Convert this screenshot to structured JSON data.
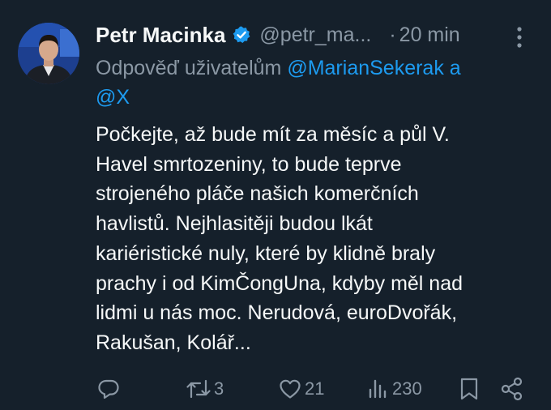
{
  "author": {
    "name": "Petr Macinka",
    "handle": "@petr_ma...",
    "separator": "·",
    "time": "20 min",
    "verified": true,
    "verified_color": "#1d9bf0"
  },
  "reply": {
    "prefix": "Odpověď uživatelům",
    "mention1": "@MarianSekerak",
    "conjunction": "a",
    "mention2": "@X"
  },
  "tweet": {
    "lines": [
      "Počkejte, až bude mít za měsíc a půl V.",
      "Havel smrtozeniny, to bude teprve",
      "strojeného pláče našich komerčních",
      "havlistů. Nejhlasitěji budou lkát",
      "kariéristické nuly, které by klidně braly",
      "prachy i od KimČongUna, kdyby měl nad",
      "lidmi u nás moc. Nerudová, euroDvořák,",
      "Rakušan, Kolář..."
    ]
  },
  "actions": {
    "reply_icon": "reply-icon",
    "retweet_count": "3",
    "like_count": "21",
    "views_count": "230",
    "bookmark_icon": "bookmark-icon",
    "share_icon": "share-icon"
  },
  "colors": {
    "background": "#15202b",
    "text": "#f7f9f9",
    "secondary": "#8b98a5",
    "accent": "#1d9bf0"
  }
}
